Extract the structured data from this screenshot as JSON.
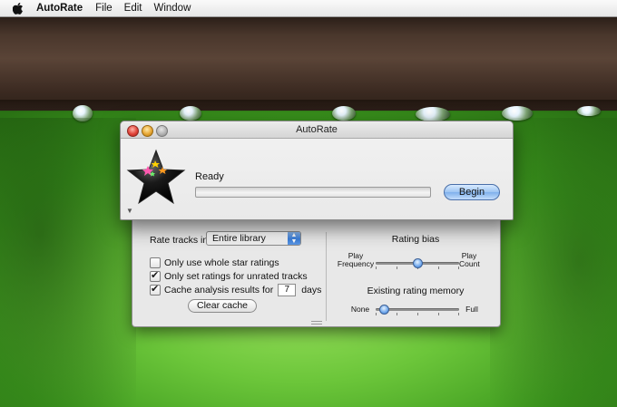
{
  "menubar": {
    "app_name": "AutoRate",
    "items": [
      "File",
      "Edit",
      "Window"
    ]
  },
  "window": {
    "title": "AutoRate",
    "status": "Ready",
    "progress": 0,
    "begin_label": "Begin"
  },
  "options": {
    "rate_tracks_label": "Rate tracks in:",
    "rate_tracks_value": "Entire library",
    "whole_star_label": "Only use whole star ratings",
    "whole_star_checked": false,
    "unrated_only_label": "Only set ratings for unrated tracks",
    "unrated_only_checked": true,
    "cache_label": "Cache analysis results for",
    "cache_checked": true,
    "cache_days": "7",
    "days_label": "days",
    "clear_cache_label": "Clear cache"
  },
  "rating_bias": {
    "heading": "Rating bias",
    "left_label_1": "Play",
    "left_label_2": "Frequency",
    "right_label_1": "Play",
    "right_label_2": "Count",
    "value": 0.5
  },
  "rating_memory": {
    "heading": "Existing rating memory",
    "left_label": "None",
    "right_label": "Full",
    "value": 0.1
  },
  "colors": {
    "accent": "#6ea7ec",
    "begin_button": "#9cc4f2"
  }
}
